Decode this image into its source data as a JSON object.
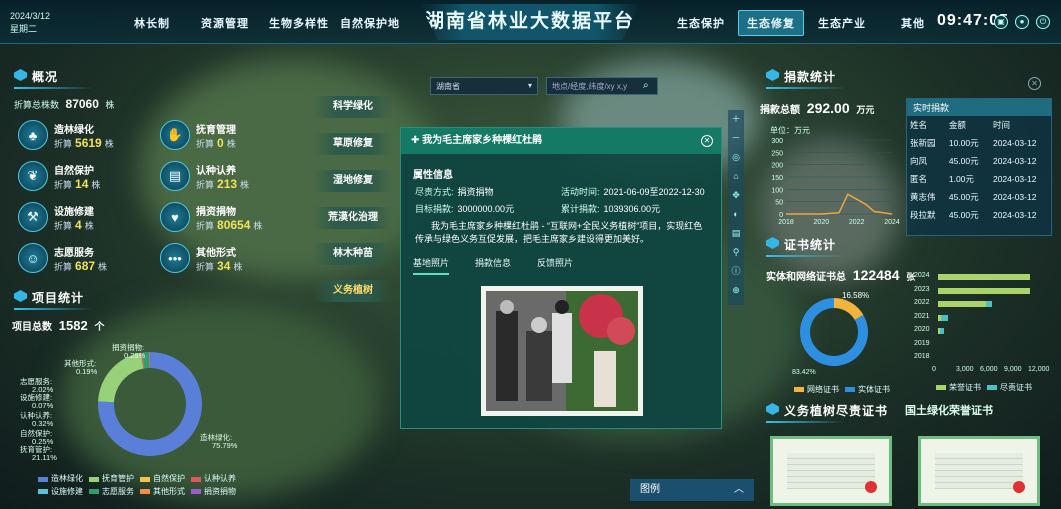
{
  "header": {
    "date": "2024/3/12",
    "weekday": "星期二",
    "title": "湖南省林业大数据平台",
    "clock": "09:47:05",
    "nav_left": [
      "林长制",
      "资源管理",
      "生物多样性",
      "自然保护地"
    ],
    "nav_right": [
      "生态保护",
      "生态修复",
      "生态产业",
      "其他"
    ],
    "active_nav": "生态修复"
  },
  "overview": {
    "title": "概况",
    "total_label": "折算总株数",
    "total_value": "87060",
    "total_unit": "株",
    "items": [
      {
        "name": "造林绿化",
        "label": "折算",
        "value": "5619",
        "unit": "株",
        "icon": "tree-icon"
      },
      {
        "name": "抚育管理",
        "label": "折算",
        "value": "0",
        "unit": "株",
        "icon": "hand-icon"
      },
      {
        "name": "自然保护",
        "label": "折算",
        "value": "14",
        "unit": "株",
        "icon": "leaf-icon"
      },
      {
        "name": "认种认养",
        "label": "折算",
        "value": "213",
        "unit": "株",
        "icon": "document-icon"
      },
      {
        "name": "设施修建",
        "label": "折算",
        "value": "4",
        "unit": "株",
        "icon": "tools-icon"
      },
      {
        "name": "捐资捐物",
        "label": "折算",
        "value": "80654",
        "unit": "株",
        "icon": "heart-hand-icon"
      },
      {
        "name": "志愿服务",
        "label": "折算",
        "value": "687",
        "unit": "株",
        "icon": "person-icon"
      },
      {
        "name": "其他形式",
        "label": "折算",
        "value": "34",
        "unit": "株",
        "icon": "more-icon"
      }
    ]
  },
  "project": {
    "title": "项目统计",
    "total_label": "项目总数",
    "total_value": "1582",
    "total_unit": "个",
    "donut": [
      {
        "name": "造林绿化",
        "pct": "75.79%",
        "value": 75.79,
        "color": "#5a7fd8"
      },
      {
        "name": "抚育管护",
        "pct": "21.11%",
        "value": 21.11,
        "color": "#97d27a"
      },
      {
        "name": "自然保护",
        "pct": "0.25%",
        "value": 0.25,
        "color": "#f2c44a"
      },
      {
        "name": "认种认养",
        "pct": "0.32%",
        "value": 0.32,
        "color": "#e0585c"
      },
      {
        "name": "设施修建",
        "pct": "0.07%",
        "value": 0.07,
        "color": "#5bc2d9"
      },
      {
        "name": "志愿服务",
        "pct": "2.02%",
        "value": 2.02,
        "color": "#2e9e6e"
      },
      {
        "name": "其他形式",
        "pct": "0.19%",
        "value": 0.19,
        "color": "#f08c4c"
      },
      {
        "name": "捐资捐物",
        "pct": "0.25%",
        "value": 0.25,
        "color": "#9b5dc9"
      }
    ],
    "legend": [
      "造林绿化",
      "抚育管护",
      "自然保护",
      "认种认养",
      "设施修建",
      "志愿服务",
      "其他形式",
      "捐资捐物"
    ]
  },
  "side_buttons": [
    "科学绿化",
    "草原修复",
    "湿地修复",
    "荒漠化治理",
    "林木种苗",
    "义务植树"
  ],
  "search": {
    "region": "湖南省",
    "placeholder": "地点/经度,纬度/xy x,y"
  },
  "modal": {
    "title": "我为毛主席家乡种棵红杜鹃",
    "section": "属性信息",
    "fields": [
      {
        "label": "尽责方式:",
        "value": "捐资捐物"
      },
      {
        "label": "活动时间:",
        "value": "2021-06-09至2022-12-30"
      },
      {
        "label": "目标捐款:",
        "value": "3000000.00元"
      },
      {
        "label": "累计捐款:",
        "value": "1039306.00元"
      }
    ],
    "desc": "我为毛主席家乡种棵红杜鹃 - “互联网+全民义务植树”项目，实现红色传承与绿色义务互促发展，把毛主席家乡建设得更加美好。",
    "tabs": [
      "基地照片",
      "捐款信息",
      "反馈照片"
    ]
  },
  "donation": {
    "title": "捐款统计",
    "total_label": "捐款总额",
    "total_value": "292.00",
    "total_unit": "万元",
    "unit_label": "单位：万元",
    "chart_data": {
      "type": "line",
      "x": [
        2018,
        2020,
        2022,
        2024
      ],
      "y_ticks": [
        0,
        50,
        100,
        150,
        200,
        250,
        300
      ],
      "ylim": [
        0,
        300
      ],
      "xlabel": "",
      "ylabel": "万元",
      "points": [
        [
          2018,
          0
        ],
        [
          2020,
          0
        ],
        [
          2021,
          5
        ],
        [
          2021.5,
          80
        ],
        [
          2022,
          60
        ],
        [
          2022.5,
          40
        ],
        [
          2023,
          10
        ],
        [
          2024,
          0
        ]
      ]
    },
    "realtime": {
      "title": "实时捐款",
      "headers": [
        "姓名",
        "金额",
        "时间"
      ],
      "rows": [
        [
          "张新园",
          "10.00元",
          "2024-03-12"
        ],
        [
          "向凤",
          "45.00元",
          "2024-03-12"
        ],
        [
          "匿名",
          "1.00元",
          "2024-03-12"
        ],
        [
          "黄志伟",
          "45.00元",
          "2024-03-12"
        ],
        [
          "段拉默",
          "45.00元",
          "2024-03-12"
        ]
      ]
    }
  },
  "cert": {
    "title": "证书统计",
    "total_label": "实体和网络证书总",
    "total_value": "122484",
    "total_unit": "张",
    "pie": [
      {
        "name": "网络证书",
        "pct": "16.58%",
        "value": 16.58,
        "color": "#f2b43c"
      },
      {
        "name": "实体证书",
        "pct": "83.42%",
        "value": 83.42,
        "color": "#2e8fe0"
      }
    ],
    "bar_chart": {
      "type": "bar",
      "categories": [
        "2024",
        "2023",
        "2022",
        "2021",
        "2020",
        "2019",
        "2018"
      ],
      "series": [
        {
          "name": "荣誉证书",
          "values": [
            11500,
            11500,
            6000,
            400,
            300,
            0,
            0
          ],
          "color": "#a8d46a"
        },
        {
          "name": "尽责证书",
          "values": [
            0,
            0,
            800,
            800,
            500,
            0,
            0
          ],
          "color": "#4cc0c6"
        }
      ],
      "x_ticks": [
        "0",
        "3,000",
        "6,000",
        "9,000",
        "12,000"
      ],
      "xlim": [
        0,
        12000
      ]
    }
  },
  "bottom": {
    "cert_title": "义务植树尽责证书",
    "cert_title2": "国土绿化荣誉证书",
    "legend_button": "图例"
  }
}
